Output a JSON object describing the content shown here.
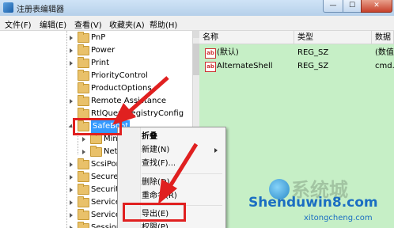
{
  "window": {
    "title": "注册表编辑器",
    "min_glyph": "—",
    "max_glyph": "☐",
    "close_glyph": "✕"
  },
  "menubar": [
    "文件(F)",
    "编辑(E)",
    "查看(V)",
    "收藏夹(A)",
    "帮助(H)"
  ],
  "tree": {
    "nodes": [
      {
        "label": "PnP",
        "expandable": true
      },
      {
        "label": "Power",
        "expandable": true
      },
      {
        "label": "Print",
        "expandable": true
      },
      {
        "label": "PriorityControl",
        "expandable": false
      },
      {
        "label": "ProductOptions",
        "expandable": false
      },
      {
        "label": "Remote Assistance",
        "expandable": true
      },
      {
        "label": "RtlQueryRegistryConfig",
        "expandable": false
      },
      {
        "label": "SafeBoot",
        "expandable": true,
        "selected": true,
        "expanded": true
      },
      {
        "label": "Minimal",
        "expandable": true,
        "child": true
      },
      {
        "label": "Network",
        "expandable": true,
        "child": true
      },
      {
        "label": "ScsiPort",
        "expandable": true
      },
      {
        "label": "SecurePipeServers",
        "expandable": true
      },
      {
        "label": "SecurityProviders",
        "expandable": true
      },
      {
        "label": "ServiceGroupOrder",
        "expandable": true
      },
      {
        "label": "ServiceProvider",
        "expandable": true
      },
      {
        "label": "Session Manager",
        "expandable": true
      }
    ]
  },
  "values_pane": {
    "columns": [
      "名称",
      "类型",
      "数据"
    ],
    "rows": [
      {
        "name": "(默认)",
        "type": "REG_SZ",
        "data": "(数值未设置)"
      },
      {
        "name": "AlternateShell",
        "type": "REG_SZ",
        "data": "cmd.exe"
      }
    ]
  },
  "context_menu": {
    "items": [
      {
        "label": "折叠",
        "bold": true
      },
      {
        "label": "新建(N)",
        "submenu": true
      },
      {
        "label": "查找(F)..."
      },
      {
        "label": "删除(D)"
      },
      {
        "label": "重命名(R)"
      },
      {
        "label": "导出(E)",
        "highlighted": true
      },
      {
        "label": "权限(P)..."
      }
    ]
  },
  "watermark": {
    "big": "系统城",
    "site": "Shenduwin8.com",
    "sub": "xitongcheng.com"
  },
  "colors": {
    "annotation": "#e02020",
    "values_bg": "#c6efc6",
    "selection": "#3399ff"
  }
}
